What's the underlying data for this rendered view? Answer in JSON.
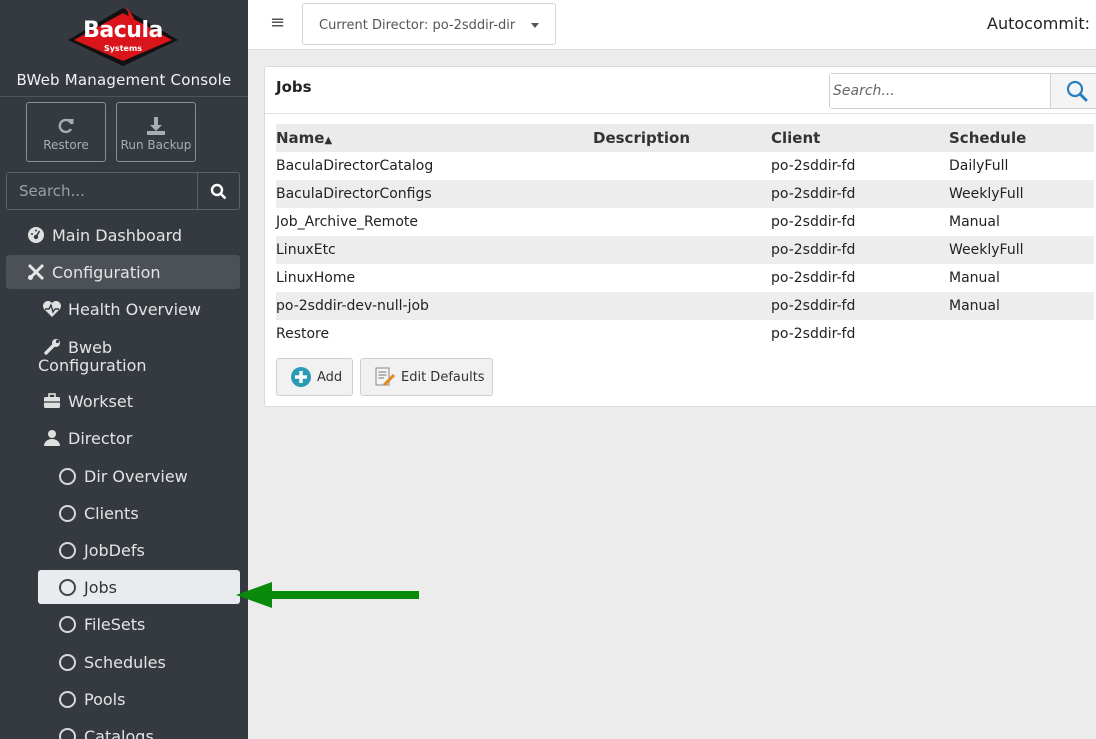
{
  "brand": {
    "logo_text": "Bacula",
    "logo_sub": "Systems",
    "console_title": "BWeb Management Console"
  },
  "sidebar": {
    "actions": [
      {
        "label": "Restore",
        "icon": "refresh-icon"
      },
      {
        "label": "Run Backup",
        "icon": "download-icon"
      }
    ],
    "search_placeholder": "Search...",
    "nav": [
      {
        "label": "Main Dashboard",
        "icon": "dashboard-icon"
      },
      {
        "label": "Configuration",
        "icon": "tools-icon",
        "active": true
      },
      {
        "label": "Health Overview",
        "icon": "heartbeat-icon"
      },
      {
        "label": "Bweb Configuration",
        "icon": "wrench-icon"
      },
      {
        "label": "Workset",
        "icon": "briefcase-icon"
      },
      {
        "label": "Director",
        "icon": "user-icon"
      },
      {
        "label": "Dir Overview",
        "icon": "circle-icon"
      },
      {
        "label": "Clients",
        "icon": "circle-icon"
      },
      {
        "label": "JobDefs",
        "icon": "circle-icon"
      },
      {
        "label": "Jobs",
        "icon": "circle-icon",
        "active": true
      },
      {
        "label": "FileSets",
        "icon": "circle-icon"
      },
      {
        "label": "Schedules",
        "icon": "circle-icon"
      },
      {
        "label": "Pools",
        "icon": "circle-icon"
      },
      {
        "label": "Catalogs",
        "icon": "circle-icon"
      }
    ]
  },
  "topbar": {
    "director_label": "Current Director: po-2sddir-dir",
    "autocommit": "Autocommit:"
  },
  "panel": {
    "title": "Jobs",
    "search_placeholder": "Search...",
    "columns": [
      "Name",
      "Description",
      "Client",
      "Schedule"
    ],
    "sort_indicator": "▲",
    "rows": [
      {
        "name": "BaculaDirectorCatalog",
        "description": "",
        "client": "po-2sddir-fd",
        "schedule": "DailyFull"
      },
      {
        "name": "BaculaDirectorConfigs",
        "description": "",
        "client": "po-2sddir-fd",
        "schedule": "WeeklyFull"
      },
      {
        "name": "Job_Archive_Remote",
        "description": "",
        "client": "po-2sddir-fd",
        "schedule": "Manual"
      },
      {
        "name": "LinuxEtc",
        "description": "",
        "client": "po-2sddir-fd",
        "schedule": "WeeklyFull"
      },
      {
        "name": "LinuxHome",
        "description": "",
        "client": "po-2sddir-fd",
        "schedule": "Manual"
      },
      {
        "name": "po-2sddir-dev-null-job",
        "description": "",
        "client": "po-2sddir-fd",
        "schedule": "Manual"
      },
      {
        "name": "Restore",
        "description": "",
        "client": "po-2sddir-fd",
        "schedule": ""
      }
    ],
    "buttons": {
      "add": "Add",
      "edit_defaults": "Edit Defaults"
    }
  },
  "colors": {
    "sidebar_bg": "#343a40",
    "arrow": "#0a8a0a",
    "logo_red": "#d9141b"
  }
}
